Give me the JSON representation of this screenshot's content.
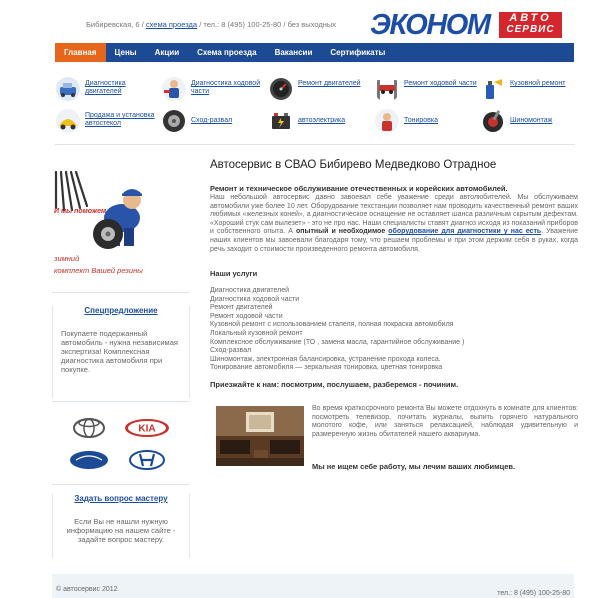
{
  "header": {
    "address": "Бибиревская, 6 /",
    "map_link": "схема проезда",
    "phone_info": "/ тел.: 8 (495) 100-25-80 / без выходных",
    "logo_main": "ЭКОНОМ",
    "logo_avto": "АВТО",
    "logo_servis": "СЕРВИС"
  },
  "nav": {
    "items": [
      "Главная",
      "Цены",
      "Акции",
      "Схема проезда",
      "Вакансии",
      "Сертификаты"
    ]
  },
  "services": [
    {
      "label": "Диагностика двигателей",
      "icon": "diagnostic-icon"
    },
    {
      "label": "Диагностика ходовой части",
      "icon": "mechanic-icon"
    },
    {
      "label": "Ремонт двигателей",
      "icon": "gauge-icon"
    },
    {
      "label": "Ремонт ходовой части",
      "icon": "lift-icon"
    },
    {
      "label": "Кузовной ремонт",
      "icon": "spray-paint-icon"
    },
    {
      "label": "Продажа и установка автостекол",
      "icon": "glass-icon"
    },
    {
      "label": "Сход-развал",
      "icon": "wheel-icon"
    },
    {
      "label": "автоэлектрика",
      "icon": "battery-icon"
    },
    {
      "label": "Тонировка",
      "icon": "tinting-icon"
    },
    {
      "label": "Шиномонтаж",
      "icon": "tire-icon"
    }
  ],
  "sidebar": {
    "promo_text1": "И мы поможем",
    "promo_text2": "зимний",
    "promo_text3": "комплект Вашей резины",
    "special_title": "Спецпредложение",
    "special_text": "Покупаете подержанный автомобиль - нужна независимая экспертиза! Комплексная диагностика автомобиля при покупке.",
    "ask_title": "Задать вопрос мастеру",
    "ask_text": "Если Вы не нашли нужную информацию на нашем сайте - задайте вопрос мастеру."
  },
  "main": {
    "title": "Автосервис в СВАО Бибирево Медведково Отрадное",
    "lead": "Ремонт и техническое обслуживание отечественных и корейских автомобилей.",
    "para1": "Наш небольшой автосервис давно завоевал себе уважение среди автолюбителей. Мы обслуживаем автомобили уже более 10 лет. Оборудование техстанции позволяет нам проводить качественный ремонт ваших любимых «железных коней», а диагностическое оснащение не оставляет шанса различным скрытым дефектам. «Хороший стук сам вылезет» - это не про нас. Наши специалисты ставят диагноз исходя из показаний приборов и собственного опыта. А",
    "para1_bold": "опытный и необходимое",
    "para1_link": "оборудование для диагностики у нас есть",
    "para1_end": ". Уважение наших клиентов мы завоевали благодаря тому, что решаем проблемы и при этом держим себя в руках, когда речь заходит о стоимости произведенного ремонта автомобиля.",
    "services_title": "Наши услуги",
    "services_list": [
      "Диагностика двигателей",
      "Диагностика ходовой части",
      "Ремонт двигателей",
      "Ремонт ходовой части",
      "Кузовной ремонт с использованием стапеля, полная покраска автомобиля",
      "Локальный кузовной ремонт",
      "Комплексное обслуживание (ТО , замена масла, гарантийное обслуживание )",
      "Сход-развал",
      "Шиномонтаж, электронная балансировка, устранение прохода колеса.",
      "Тонирование автомобиля — зеркальная тонировка, цветная тонировка"
    ],
    "invite": "Приезжайте к нам: посмотрим, послушаем, разберемся - починим.",
    "waiting_text": "Во время краткосрочного ремонта Вы можете отдохнуть в комнате для клиентов: посмотреть телевизор, почитать журналы, выпить горячего натурального молотого кофе, или заняться релаксацией, наблюдая удивительную и размеренную жизнь обитателей нашего аквариума.",
    "motto": "Мы не ищем себе работу, мы лечим ваших любимцев."
  },
  "brands": [
    "toyota-logo",
    "kia-logo",
    "hyundai-logo",
    "hyundai-h-logo"
  ],
  "footer": {
    "copyright": "© автосервис 2012",
    "phone": "тел.: 8 (495) 100-25-80"
  }
}
